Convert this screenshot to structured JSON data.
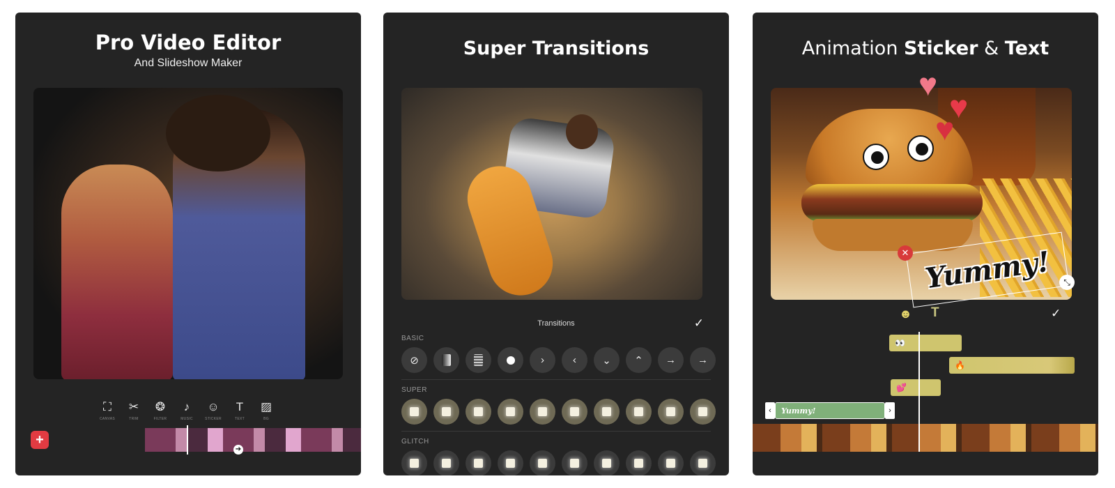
{
  "panel1": {
    "title": "Pro Video Editor",
    "subtitle": "And Slideshow Maker",
    "tools": [
      {
        "icon": "crop-icon",
        "glyph": "⛶",
        "label": "CANVAS"
      },
      {
        "icon": "scissors-icon",
        "glyph": "✂",
        "label": "TRIM"
      },
      {
        "icon": "filter-icon",
        "glyph": "❂",
        "label": "FILTER"
      },
      {
        "icon": "music-icon",
        "glyph": "♪",
        "label": "MUSIC"
      },
      {
        "icon": "sticker-icon",
        "glyph": "☺",
        "label": "STICKER"
      },
      {
        "icon": "text-icon",
        "glyph": "T",
        "label": "TEXT"
      },
      {
        "icon": "background-icon",
        "glyph": "▨",
        "label": "BG"
      }
    ],
    "add_glyph": "+",
    "play_glyph": "➔"
  },
  "panel2": {
    "title": "Super Transitions",
    "header": "Transitions",
    "check_glyph": "✓",
    "sections": {
      "basic": "BASIC",
      "super": "SUPER",
      "glitch": "GLITCH"
    },
    "basic_glyphs": [
      "⊘",
      "",
      "",
      "",
      "›",
      "‹",
      "⌄",
      "⌃",
      "→",
      "→"
    ]
  },
  "panel3": {
    "title_prefix": "Animation ",
    "title_sticker": "Sticker",
    "title_amp": " & ",
    "title_text": "Text",
    "sticker_text": "Yummy!",
    "delete_glyph": "✕",
    "resize_glyph": "⤡",
    "emoji_glyph": "☻",
    "text_glyph": "T",
    "check_glyph": "✓",
    "heart_glyph": "♥",
    "tracks": {
      "eyes": "👀",
      "fire": "🔥",
      "hearts": "💕",
      "text": "Yummy!"
    },
    "handle_left": "‹",
    "handle_right": "›"
  },
  "colors": {
    "panel_bg": "#242424",
    "accent_red": "#e23b42",
    "track_yellow": "#cfc56e",
    "track_green": "#80b07a"
  }
}
